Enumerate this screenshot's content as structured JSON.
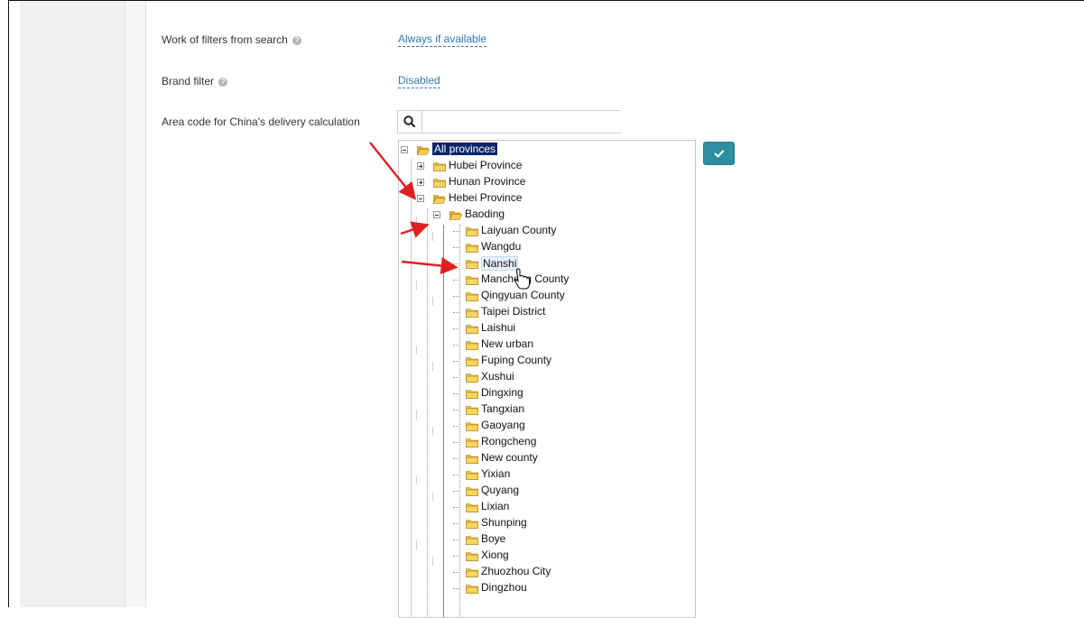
{
  "settings": {
    "filters_from_search": {
      "label": "Work of filters from search",
      "value": "Always if available"
    },
    "brand_filter": {
      "label": "Brand filter",
      "value": "Disabled"
    },
    "area_code": {
      "label": "Area code for China's delivery calculation"
    }
  },
  "search": {
    "value": "",
    "placeholder": ""
  },
  "tree": {
    "root": "All provinces",
    "provinces": [
      "Hubei Province",
      "Hunan Province",
      "Hebei Province"
    ],
    "city": "Baoding",
    "districts": [
      "Laiyuan County",
      "Wangdu",
      "Nanshi",
      "Mancheng County",
      "Qingyuan County",
      "Taipei District",
      "Laishui",
      "New urban",
      "Fuping County",
      "Xushui",
      "Dingxing",
      "Tangxian",
      "Gaoyang",
      "Rongcheng",
      "New county",
      "Yixian",
      "Quyang",
      "Lixian",
      "Shunping",
      "Boye",
      "Xiong",
      "Zhuozhou City",
      "Dingzhou"
    ]
  },
  "colors": {
    "link": "#2a7ab8",
    "button": "#2b8ea1",
    "selected": "#0a246a",
    "arrow": "#e02020",
    "folder": "#f3c23a"
  }
}
